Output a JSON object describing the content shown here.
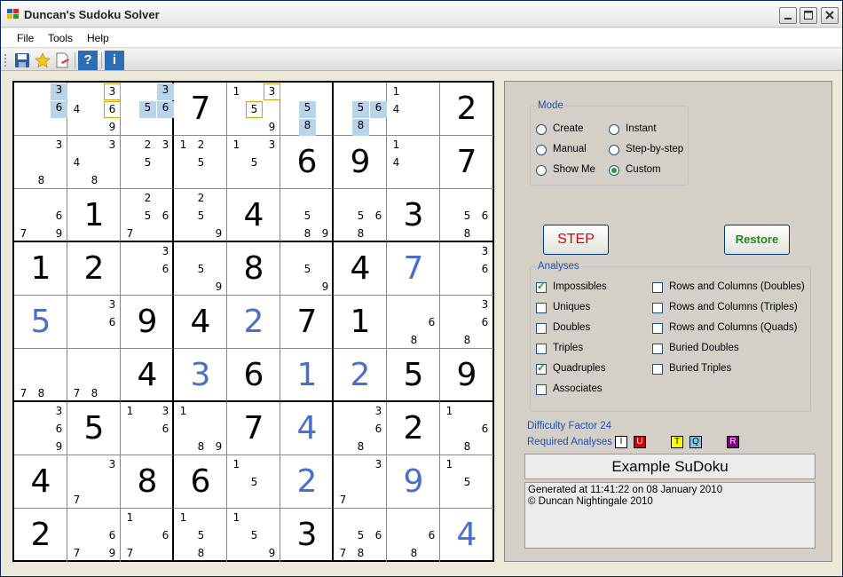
{
  "window": {
    "title": "Duncan's Sudoku Solver"
  },
  "menu": [
    "File",
    "Tools",
    "Help"
  ],
  "toolbar": {
    "icons": [
      "save-icon",
      "star-icon",
      "clear-icon",
      "help-icon",
      "info-icon"
    ],
    "help_label": "?",
    "info_label": "i"
  },
  "grid": {
    "solved_color": "#4a6fc9",
    "cells": [
      [
        {
          "c": [
            3,
            6
          ],
          "hl": [
            3,
            6
          ]
        },
        {
          "c": [
            3,
            4,
            6,
            9
          ],
          "box": [
            3,
            6
          ]
        },
        {
          "c": [
            3,
            5,
            6
          ],
          "hl": [
            3,
            5,
            6
          ]
        },
        {
          "v": "7"
        },
        {
          "c": [
            1,
            3,
            5,
            9
          ],
          "box": [
            3,
            5
          ]
        },
        {
          "c": [
            5,
            8
          ],
          "hl": [
            5,
            8
          ]
        },
        {
          "c": [
            5,
            6,
            8
          ],
          "hl": [
            5,
            6,
            8
          ]
        },
        {
          "c": [
            1,
            4
          ]
        },
        {
          "v": "2"
        }
      ],
      [
        {
          "c": [
            3,
            8
          ]
        },
        {
          "c": [
            3,
            4,
            8
          ]
        },
        {
          "c": [
            2,
            3,
            5
          ]
        },
        {
          "c": [
            1,
            2,
            5
          ]
        },
        {
          "c": [
            1,
            3,
            5
          ]
        },
        {
          "v": "6"
        },
        {
          "v": "9"
        },
        {
          "c": [
            1,
            4
          ]
        },
        {
          "v": "7"
        }
      ],
      [
        {
          "c": [
            6,
            7,
            9
          ]
        },
        {
          "v": "1"
        },
        {
          "c": [
            2,
            5,
            6,
            7
          ]
        },
        {
          "c": [
            2,
            5,
            9
          ]
        },
        {
          "v": "4"
        },
        {
          "c": [
            5,
            8,
            9
          ]
        },
        {
          "c": [
            5,
            6,
            8
          ]
        },
        {
          "v": "3"
        },
        {
          "c": [
            5,
            6,
            8
          ]
        }
      ],
      [
        {
          "v": "1"
        },
        {
          "v": "2"
        },
        {
          "c": [
            3,
            6
          ]
        },
        {
          "c": [
            5,
            9
          ]
        },
        {
          "v": "8"
        },
        {
          "c": [
            5,
            9
          ]
        },
        {
          "v": "4"
        },
        {
          "v": "7",
          "s": 1
        },
        {
          "c": [
            3,
            6
          ]
        }
      ],
      [
        {
          "v": "5",
          "s": 1
        },
        {
          "c": [
            3,
            6
          ]
        },
        {
          "v": "9"
        },
        {
          "v": "4"
        },
        {
          "v": "2",
          "s": 1
        },
        {
          "v": "7"
        },
        {
          "v": "1"
        },
        {
          "c": [
            6,
            8
          ]
        },
        {
          "c": [
            3,
            6,
            8
          ]
        }
      ],
      [
        {
          "c": [
            7,
            8
          ]
        },
        {
          "c": [
            7,
            8
          ]
        },
        {
          "v": "4"
        },
        {
          "v": "3",
          "s": 1
        },
        {
          "v": "6"
        },
        {
          "v": "1",
          "s": 1
        },
        {
          "v": "2",
          "s": 1
        },
        {
          "v": "5"
        },
        {
          "v": "9"
        }
      ],
      [
        {
          "c": [
            3,
            6,
            9
          ]
        },
        {
          "v": "5"
        },
        {
          "c": [
            1,
            3,
            6
          ]
        },
        {
          "c": [
            1,
            8,
            9
          ]
        },
        {
          "v": "7"
        },
        {
          "v": "4",
          "s": 1
        },
        {
          "c": [
            3,
            6,
            8
          ]
        },
        {
          "v": "2"
        },
        {
          "c": [
            1,
            6,
            8
          ]
        }
      ],
      [
        {
          "v": "4"
        },
        {
          "c": [
            3,
            7
          ]
        },
        {
          "v": "8"
        },
        {
          "v": "6"
        },
        {
          "c": [
            1,
            5
          ]
        },
        {
          "v": "2",
          "s": 1
        },
        {
          "c": [
            3,
            7
          ]
        },
        {
          "v": "9",
          "s": 1
        },
        {
          "c": [
            1,
            5
          ]
        }
      ],
      [
        {
          "v": "2"
        },
        {
          "c": [
            6,
            7,
            9
          ]
        },
        {
          "c": [
            1,
            6,
            7
          ]
        },
        {
          "c": [
            1,
            5,
            8
          ]
        },
        {
          "c": [
            1,
            5,
            9
          ]
        },
        {
          "v": "3"
        },
        {
          "c": [
            5,
            6,
            7,
            8
          ]
        },
        {
          "c": [
            6,
            8
          ]
        },
        {
          "v": "4",
          "s": 1
        }
      ]
    ]
  },
  "mode": {
    "legend": "Mode",
    "options": [
      {
        "label": "Create",
        "selected": false
      },
      {
        "label": "Instant",
        "selected": false
      },
      {
        "label": "Manual",
        "selected": false
      },
      {
        "label": "Step-by-step",
        "selected": false
      },
      {
        "label": "Show Me",
        "selected": false
      },
      {
        "label": "Custom",
        "selected": true
      }
    ]
  },
  "buttons": {
    "step": "STEP",
    "restore": "Restore"
  },
  "analyses": {
    "legend": "Analyses",
    "items": [
      {
        "label": "Impossibles",
        "checked": true
      },
      {
        "label": "Rows and Columns (Doubles)",
        "checked": false
      },
      {
        "label": "Uniques",
        "checked": false
      },
      {
        "label": "Rows and Columns (Triples)",
        "checked": false
      },
      {
        "label": "Doubles",
        "checked": false
      },
      {
        "label": "Rows and Columns (Quads)",
        "checked": false
      },
      {
        "label": "Triples",
        "checked": false
      },
      {
        "label": "Buried Doubles",
        "checked": false
      },
      {
        "label": "Quadruples",
        "checked": true
      },
      {
        "label": "Buried Triples",
        "checked": false
      },
      {
        "label": "Associates",
        "checked": false
      }
    ]
  },
  "difficulty": {
    "label": "Difficulty Factor 24"
  },
  "required": {
    "label": "Required Analyses",
    "badges": [
      {
        "text": "I",
        "bg": "#ffffff",
        "fg": "#000000"
      },
      {
        "text": "U",
        "bg": "#d00000",
        "fg": "#ffffff"
      },
      {
        "text": "T",
        "bg": "#ffff00",
        "fg": "#000000"
      },
      {
        "text": "Q",
        "bg": "#7ec8ef",
        "fg": "#000000"
      },
      {
        "text": "R",
        "bg": "#800080",
        "fg": "#ffffff"
      }
    ]
  },
  "puzzle_title": "Example SuDoku",
  "info_lines": [
    "Generated at 11:41:22 on 08 January 2010",
    "© Duncan Nightingale 2010"
  ],
  "colors": {
    "label_blue": "#1f4fb0",
    "window_bg": "#ece9d8",
    "panel_bg": "#d4d0c8"
  }
}
